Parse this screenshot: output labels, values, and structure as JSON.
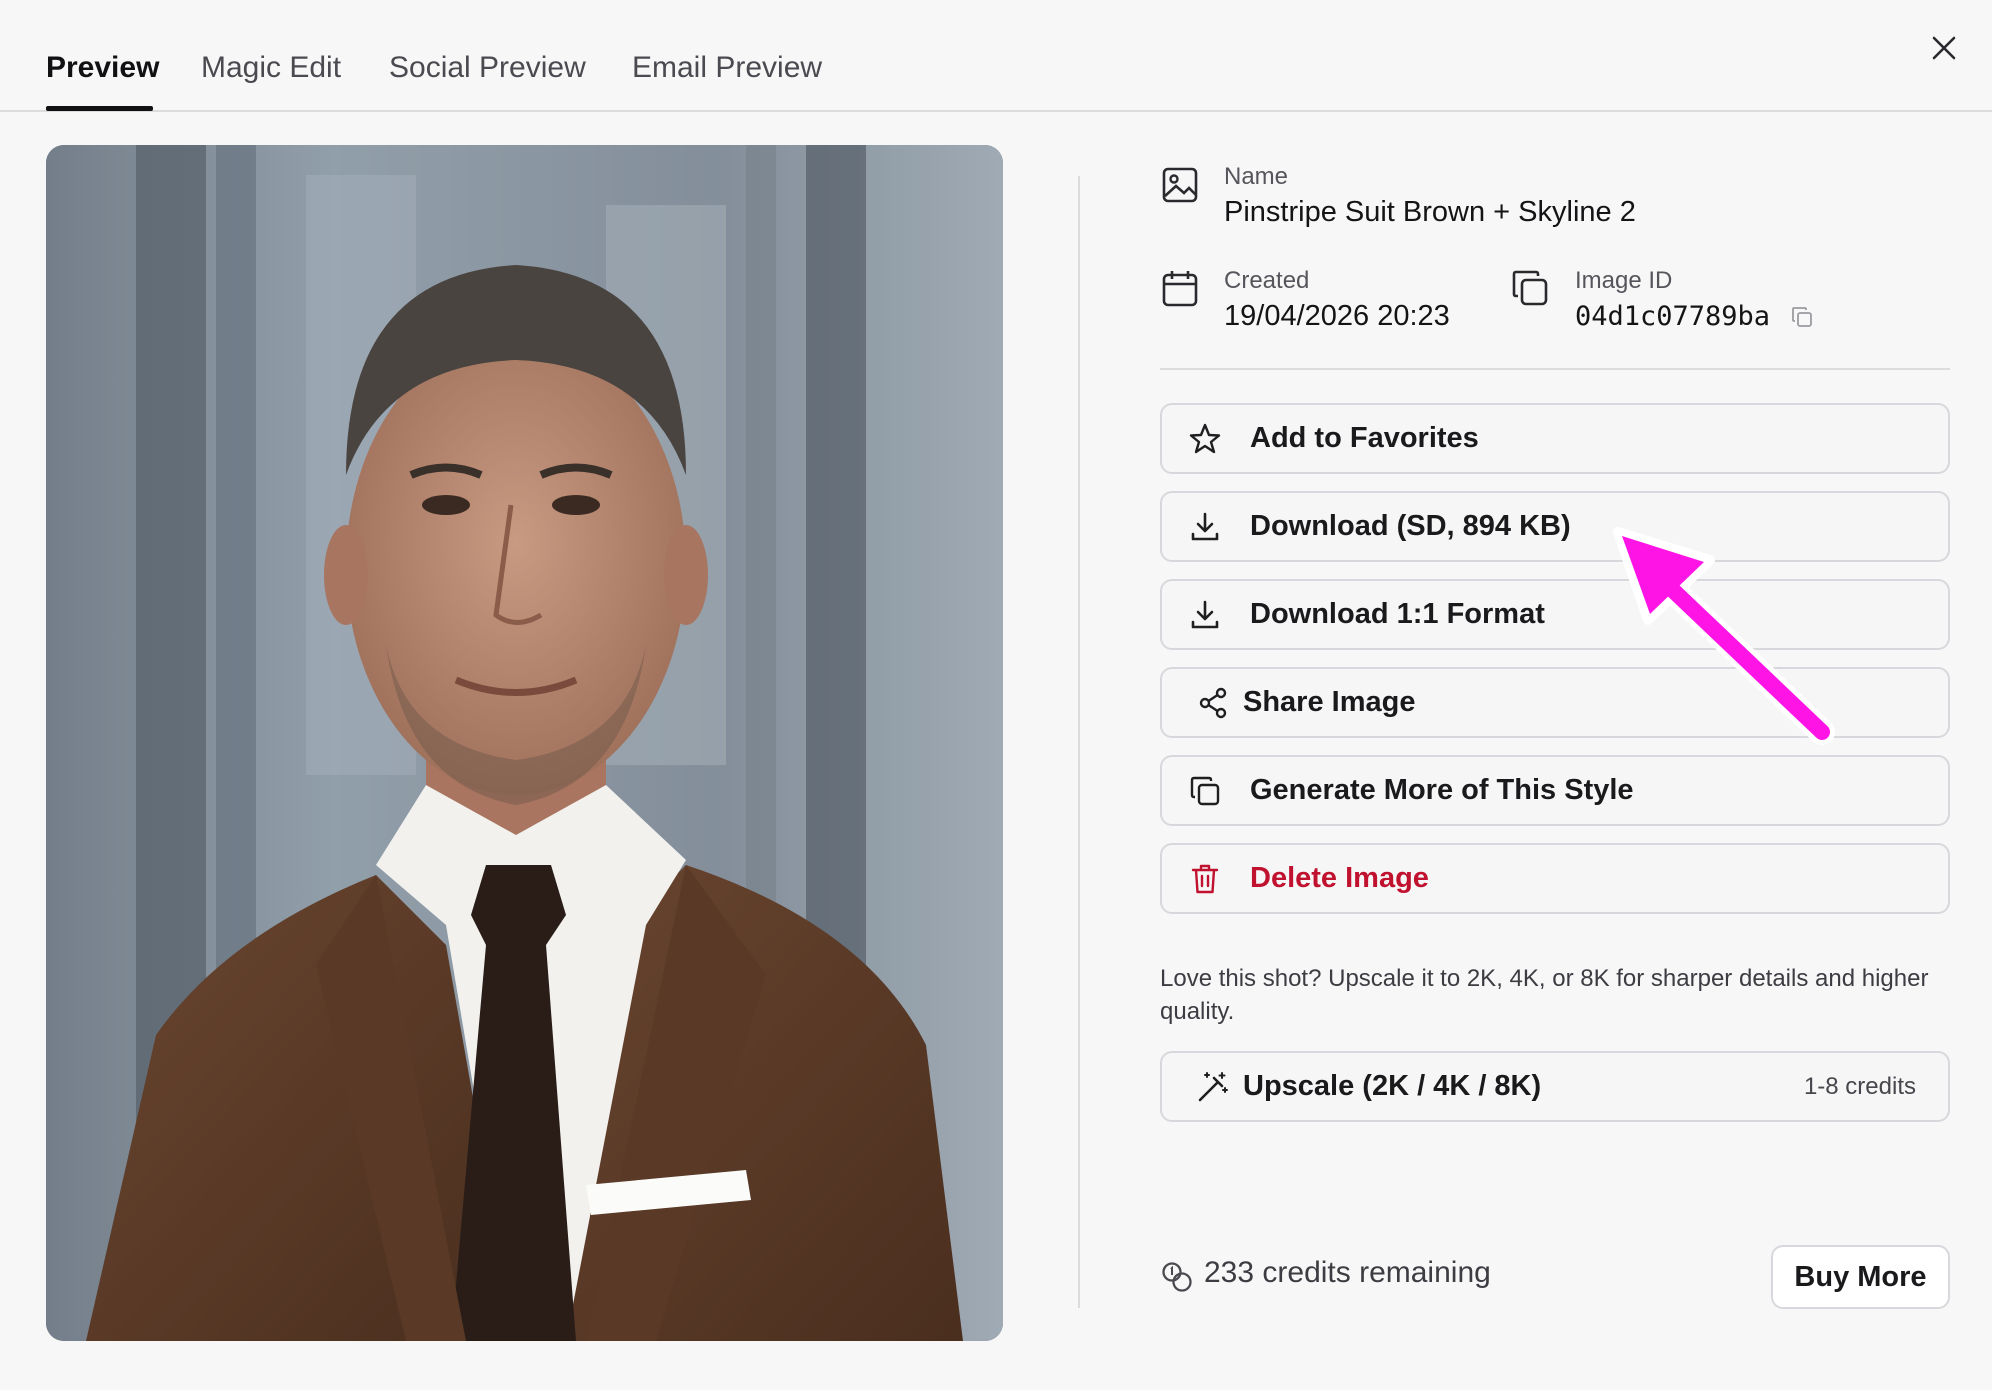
{
  "tabs": [
    {
      "label": "Preview",
      "active": true
    },
    {
      "label": "Magic Edit",
      "active": false
    },
    {
      "label": "Social Preview",
      "active": false
    },
    {
      "label": "Email Preview",
      "active": false
    }
  ],
  "image": {
    "icon": "portrait-photo",
    "alt_subject": "professional headshot of man in brown suit with skyline background"
  },
  "meta": {
    "name_label": "Name",
    "name_value": "Pinstripe Suit Brown + Skyline 2",
    "created_label": "Created",
    "created_value": "19/04/2026 20:23",
    "image_id_label": "Image ID",
    "image_id_value": "04d1c07789ba"
  },
  "actions": {
    "favorites": "Add to Favorites",
    "download_sd": "Download (SD, 894 KB)",
    "download_square": "Download 1:1 Format",
    "share": "Share Image",
    "generate_more": "Generate More of This Style",
    "delete": "Delete Image"
  },
  "promo_text": "Love this shot? Upscale it to 2K, 4K, or 8K for sharper details and higher quality.",
  "upscale": {
    "label": "Upscale (2K / 4K / 8K)",
    "cost": "1-8 credits"
  },
  "credits": {
    "remaining": "233 credits remaining",
    "buy_label": "Buy More"
  },
  "colors": {
    "danger": "#c0112f",
    "annotation_arrow": "#ff14e6",
    "background": "#f8f7f7",
    "border": "#d8d8dc"
  }
}
